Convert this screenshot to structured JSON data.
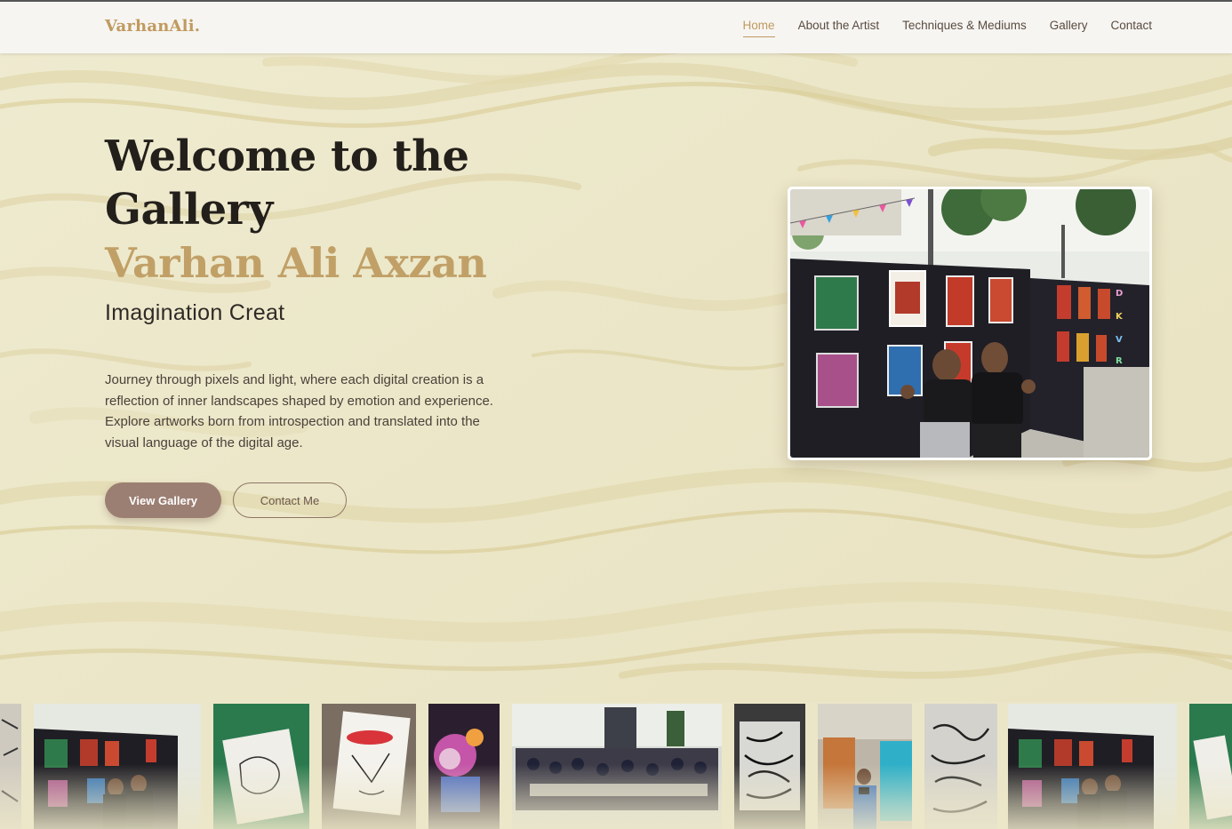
{
  "header": {
    "logo": "VarhanAli.",
    "nav": [
      {
        "label": "Home",
        "active": true
      },
      {
        "label": "About the Artist",
        "active": false
      },
      {
        "label": "Techniques & Mediums",
        "active": false
      },
      {
        "label": "Gallery",
        "active": false
      },
      {
        "label": "Contact",
        "active": false
      }
    ]
  },
  "hero": {
    "title_line1": "Welcome to the",
    "title_line2": "Gallery",
    "artist_name": "Varhan Ali Axzan",
    "subtitle": "Imagination Creat",
    "description": "Journey through pixels and light, where each digital creation is a reflection of inner landscapes shaped by emotion and experience. Explore artworks born from introspection and translated into the visual language of the digital age.",
    "primary_button": "View Gallery",
    "secondary_button": "Contact Me"
  },
  "colors": {
    "accent_gold": "#c09a5e",
    "button_mauve": "#9c7f73",
    "header_bg": "#f6f5f2",
    "marble_base": "#ece7c9"
  },
  "gallery_strip": {
    "thumbnails": [
      "exhibition-booth-photo",
      "sketchbook-drawing-photo",
      "doodle-sketch-photo",
      "psychedelic-painting-photo",
      "classroom-workshop-photo",
      "ink-doodle-art-photo",
      "artist-with-camera-photo",
      "black-white-illustration-photo",
      "exhibition-booth-photo"
    ]
  }
}
